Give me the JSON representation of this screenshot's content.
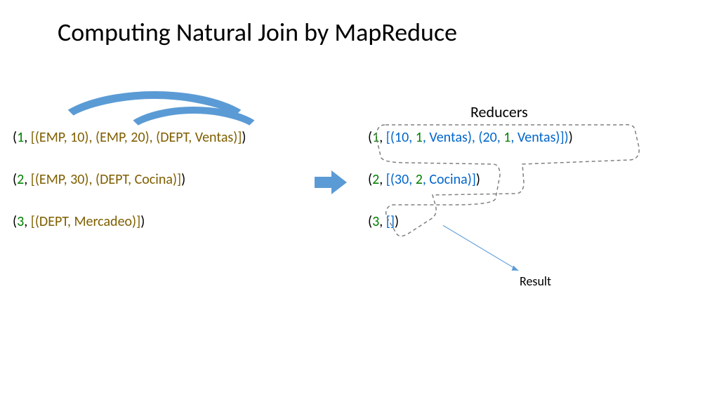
{
  "title": "Computing Natural Join by MapReduce",
  "reducers_label": "Reducers",
  "result_label": "Result",
  "left_rows": [
    {
      "key": "1",
      "list": "[(EMP, 10), (EMP, 20), (DEPT, Ventas)]"
    },
    {
      "key": "2",
      "list": "[(EMP, 30), (DEPT, Cocina)]"
    },
    {
      "key": "3",
      "list": "[(DEPT, Mercadeo)]"
    }
  ],
  "right_rows": [
    {
      "key": "1",
      "segments": [
        {
          "t": "[(10, ",
          "c": "r-blu"
        },
        {
          "t": "1",
          "c": "k-grn"
        },
        {
          "t": ", Ventas), (20, ",
          "c": "r-blu"
        },
        {
          "t": "1",
          "c": "k-grn"
        },
        {
          "t": ", Ventas)])",
          "c": "r-blu"
        }
      ],
      "trail": ")"
    },
    {
      "key": "2",
      "segments": [
        {
          "t": "[(30, ",
          "c": "r-blu"
        },
        {
          "t": "2",
          "c": "k-grn"
        },
        {
          "t": ", Cocina)]",
          "c": "r-blu"
        }
      ],
      "trail": ")"
    },
    {
      "key": "3",
      "segments": [
        {
          "t": "[]",
          "c": "r-blu"
        }
      ],
      "trail": ")"
    }
  ],
  "colors": {
    "arc_fill": "#5b9bd5",
    "key_green": "#008000",
    "left_brown": "#7f5f00",
    "right_blue": "#0066cc",
    "dash": "#808080"
  }
}
